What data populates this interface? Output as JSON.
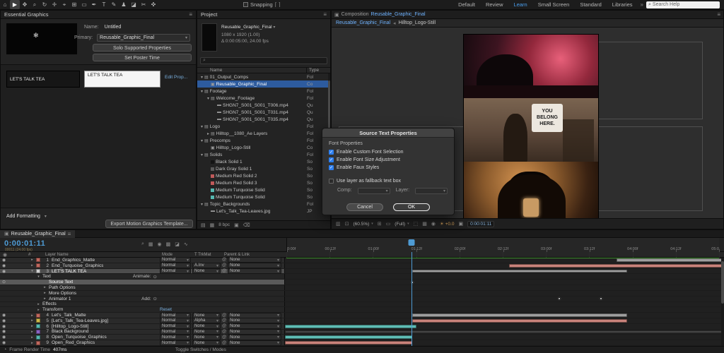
{
  "colors": {
    "accent_blue": "#4e9bd4",
    "selection_blue": "#2d5b9e",
    "turquoise": "#5fbdb5",
    "salmon": "#c9837b",
    "red_label": "#c0685e",
    "gray_bar": "#9f9f9f",
    "dark_bar": "#454545",
    "yellow_label": "#cdb84a"
  },
  "toolbar": {
    "tools": [
      {
        "name": "home-tool",
        "glyph": "⌂"
      },
      {
        "name": "selection-tool",
        "glyph": "▶",
        "active": true
      },
      {
        "name": "hand-tool",
        "glyph": "✥"
      },
      {
        "name": "zoom-tool",
        "glyph": "⌕"
      },
      {
        "name": "orbit-camera-tool",
        "glyph": "↻"
      },
      {
        "name": "pan-camera-tool",
        "glyph": "✛"
      },
      {
        "name": "dolly-camera-tool",
        "glyph": "⌖"
      },
      {
        "name": "pan-behind-tool",
        "glyph": "⊞"
      },
      {
        "name": "shape-tool",
        "glyph": "▭"
      },
      {
        "name": "pen-tool",
        "glyph": "✒"
      },
      {
        "name": "type-tool",
        "glyph": "T"
      },
      {
        "name": "brush-tool",
        "glyph": "✎"
      },
      {
        "name": "clone-stamp-tool",
        "glyph": "♟"
      },
      {
        "name": "eraser-tool",
        "glyph": "◪"
      },
      {
        "name": "roto-brush-tool",
        "glyph": "✂"
      },
      {
        "name": "puppet-pin-tool",
        "glyph": "✜"
      }
    ],
    "snapping_label": "Snapping",
    "workspaces": [
      "Default",
      "Review",
      "Learn",
      "Small Screen",
      "Standard",
      "Libraries"
    ],
    "active_workspace": "Learn",
    "search_placeholder": "Search Help"
  },
  "essential_graphics": {
    "title": "Essential Graphics",
    "name_label": "Name:",
    "name_value": "Untitled",
    "primary_label": "Primary:",
    "primary_value": "Reusable_Graphic_Final",
    "solo_button": "Solo Supported Properties",
    "poster_button": "Set Poster Time",
    "property_name": "LET'S TALK TEA",
    "property_value": "LET'S TALK TEA",
    "edit_link": "Edit Prop...",
    "add_formatting_label": "Add Formatting",
    "export_button": "Export Motion Graphics Template..."
  },
  "project_panel": {
    "tab": "Project",
    "comp_name": "Reusable_Graphic_Final",
    "comp_dims": "1080 x 1920 (1.00)",
    "comp_time": "0:00:05:00, 24.00 fps",
    "columns": {
      "name": "Name",
      "type": "Type"
    },
    "footer_bit_depth": "8 bpc",
    "items": [
      {
        "name": "01_Output_Comps",
        "type": "Fol",
        "level": 0,
        "kind": "folder",
        "expanded": true
      },
      {
        "name": "Reusable_Graphic_Final",
        "type": "Co",
        "level": 1,
        "kind": "comp",
        "selected": true
      },
      {
        "name": "Footage",
        "type": "Fol",
        "level": 0,
        "kind": "folder",
        "expanded": true
      },
      {
        "name": "Welcome_Footage",
        "type": "Fol",
        "level": 1,
        "kind": "folder",
        "expanded": true
      },
      {
        "name": "SHGN7_S001_S001_T006.mp4",
        "type": "Qu",
        "level": 2,
        "kind": "footage"
      },
      {
        "name": "SHGN7_S001_S001_T031.mp4",
        "type": "Qu",
        "level": 2,
        "kind": "footage"
      },
      {
        "name": "SHGN7_S001_S001_T035.mp4",
        "type": "Qu",
        "level": 2,
        "kind": "footage"
      },
      {
        "name": "Logo",
        "type": "Fol",
        "level": 0,
        "kind": "folder",
        "expanded": true
      },
      {
        "name": "Hilltop__1080_Ae Layers",
        "type": "Fol",
        "level": 1,
        "kind": "folder"
      },
      {
        "name": "Precomps",
        "type": "Fol",
        "level": 0,
        "kind": "folder",
        "expanded": true
      },
      {
        "name": "Hilltop_Logo-Still",
        "type": "Co",
        "level": 1,
        "kind": "comp"
      },
      {
        "name": "Solids",
        "type": "Fol",
        "level": 0,
        "kind": "folder",
        "expanded": true
      },
      {
        "name": "Black Solid 1",
        "type": "So",
        "level": 1,
        "kind": "solid",
        "chip": "#141414"
      },
      {
        "name": "Dark Gray Solid 1",
        "type": "So",
        "level": 1,
        "kind": "solid",
        "chip": "#5a5a5a"
      },
      {
        "name": "Medium Red Solid 2",
        "type": "So",
        "level": 1,
        "kind": "solid",
        "chip": "#c05a5a"
      },
      {
        "name": "Medium Red Solid 3",
        "type": "So",
        "level": 1,
        "kind": "solid",
        "chip": "#c05a5a"
      },
      {
        "name": "Medium Turquoise Solid",
        "type": "So",
        "level": 1,
        "kind": "solid",
        "chip": "#56b8b0"
      },
      {
        "name": "Medium Turquoise Solid",
        "type": "So",
        "level": 1,
        "kind": "solid",
        "chip": "#56b8b0"
      },
      {
        "name": "Topic_Backgrounds",
        "type": "Fol",
        "level": 0,
        "kind": "folder",
        "expanded": true
      },
      {
        "name": "Let's_Talk_Tea-Leaves.jpg",
        "type": "JP",
        "level": 1,
        "kind": "footage"
      }
    ]
  },
  "viewer": {
    "panel_label": "Composition",
    "comp_name": "Reusable_Graphic_Final",
    "breadcrumb_current": "Reusable_Graphic_Final",
    "breadcrumb_parent": "Hilltop_Logo-Still",
    "sign_line1": "YOU",
    "sign_line2": "BELONG",
    "sign_line3": "HERE.",
    "zoom": "(60.5%)",
    "resolution": "(Full)",
    "exposure": "+0.0",
    "timecode": "0:00:01:11"
  },
  "dialog": {
    "title": "Source Text Properties",
    "section": "Font Properties",
    "checkboxes": [
      {
        "label": "Enable Custom Font Selection",
        "checked": true
      },
      {
        "label": "Enable Font Size Adjustment",
        "checked": true
      },
      {
        "label": "Enable Faux Styles",
        "checked": true
      }
    ],
    "fallback_checkbox": {
      "label": "Use layer as fallback text box",
      "checked": false
    },
    "comp_label": "Comp:",
    "layer_label": "Layer:",
    "cancel_label": "Cancel",
    "ok_label": "OK"
  },
  "timeline": {
    "tab": "Reusable_Graphic_Final",
    "timecode": "0:00:01:11",
    "frame_info": "00011 (24.00 fps)",
    "columns": {
      "index": "#",
      "name": "Layer Name",
      "mode": "Mode",
      "trkmat": "T TrkMat",
      "parent": "Parent & Link"
    },
    "ruler": [
      "0:00f",
      "00:12f",
      "01:00f",
      "01:12f",
      "02:00f",
      "02:12f",
      "03:00f",
      "03:12f",
      "04:00f",
      "04:12f",
      "05:0"
    ],
    "playhead_frac": 0.29,
    "status_render_label": "Frame Render Time",
    "status_render_value": "407ms",
    "status_center": "Toggle Switches / Modes",
    "rows": [
      {
        "kind": "layer",
        "idx": "1",
        "name": "End_Graphics_Matte",
        "mode": "Normal",
        "trkmat": "",
        "parent": "None",
        "chip": "#c0685e",
        "bar": [
          0.755,
          0.995
        ],
        "barColor": "#9f9f9f"
      },
      {
        "kind": "layer",
        "idx": "2",
        "name": "End_Turquoise_Graphics",
        "mode": "Normal",
        "trkmat": "A.Inv",
        "parent": "None",
        "chip": "#c0685e",
        "bar": [
          0.51,
          0.995
        ],
        "barColor": "#c9837b"
      },
      {
        "kind": "layer",
        "idx": "3",
        "name": "LET'S TALK TEA",
        "mode": "Normal",
        "trkmat": "None",
        "parent": "None",
        "chip": "#cfcfcf",
        "selected": true,
        "expanded": true,
        "bar": [
          0.29,
          0.78
        ],
        "barColor": "#9f9f9f"
      },
      {
        "kind": "group",
        "indent": 1,
        "name": "Text",
        "extra": "Animate:",
        "expanded": true
      },
      {
        "kind": "prop",
        "indent": 2,
        "name": "Source Text",
        "selected": true,
        "keys": [
          0.29
        ]
      },
      {
        "kind": "group",
        "indent": 2,
        "name": "Path Options"
      },
      {
        "kind": "group",
        "indent": 2,
        "name": "More Options"
      },
      {
        "kind": "group",
        "indent": 2,
        "name": "Animator 1",
        "extra": "Add:",
        "keys": [
          0.625,
          0.72
        ]
      },
      {
        "kind": "group",
        "indent": 1,
        "name": "Effects"
      },
      {
        "kind": "group",
        "indent": 1,
        "name": "Transform",
        "extra": "Reset",
        "reset": true
      },
      {
        "kind": "layer",
        "idx": "4",
        "name": "Let's_Talk_Matte",
        "mode": "Normal",
        "trkmat": "None",
        "parent": "None",
        "chip": "#c0685e",
        "bar": [
          0.29,
          0.78
        ],
        "barColor": "#9f9f9f"
      },
      {
        "kind": "layer",
        "idx": "5",
        "name": "[Let's_Talk_Tea-Leaves.jpg]",
        "mode": "Normal",
        "trkmat": "Alpha",
        "parent": "None",
        "chip": "#cdb84a",
        "bar": [
          0.29,
          0.78
        ],
        "barColor": "#c9837b"
      },
      {
        "kind": "layer",
        "idx": "6",
        "name": "[Hilltop_Logo-Still]",
        "mode": "Normal",
        "trkmat": "None",
        "parent": "None",
        "chip": "#56b8b0",
        "bar": [
          0.0,
          0.3
        ],
        "barColor": "#5fbdb5"
      },
      {
        "kind": "layer",
        "idx": "7",
        "name": "Black Background",
        "mode": "Normal",
        "trkmat": "None",
        "parent": "None",
        "chip": "#8a63c2",
        "bar": [
          0.0,
          0.995
        ],
        "barColor": "#454545"
      },
      {
        "kind": "layer",
        "idx": "8",
        "name": "Open_Turquoise_Graphics",
        "mode": "Normal",
        "trkmat": "None",
        "parent": "None",
        "chip": "#56b8b0",
        "bar": [
          0.0,
          0.29
        ],
        "barColor": "#5fbdb5"
      },
      {
        "kind": "layer",
        "idx": "9",
        "name": "Open_Red_Graphics",
        "mode": "Normal",
        "trkmat": "None",
        "parent": "None",
        "chip": "#c0685e",
        "bar": [
          0.0,
          0.29
        ],
        "barColor": "#c9837b"
      }
    ]
  }
}
